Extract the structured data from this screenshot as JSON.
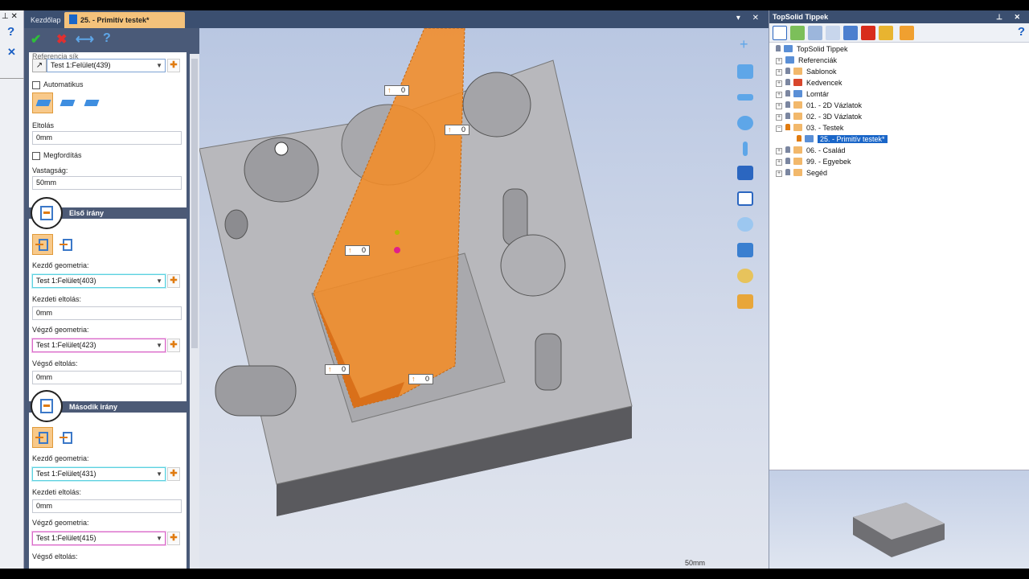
{
  "strip": {
    "pin": "⊥ ✕",
    "help": "?",
    "close": "✕"
  },
  "tabs": {
    "home": "Kezdőlap",
    "active": "25. - Primitív testek*",
    "controls": "▾ ✕"
  },
  "toolbar": {
    "ok": "✔",
    "cancel": "✖",
    "extra": "⟷",
    "help": "?"
  },
  "panel": {
    "ref_label": "Referencia sík",
    "ref_value": "Test 1:Felület(439)",
    "auto_label": "Automatikus",
    "offset_label": "Eltolás",
    "offset_value": "0mm",
    "flip_label": "Megfordítás",
    "thickness_label": "Vastagság:",
    "thickness_value": "50mm",
    "dir1": {
      "title": "Első irány",
      "start_geo_label": "Kezdő geometria:",
      "start_geo_value": "Test 1:Felület(403)",
      "start_offset_label": "Kezdeti eltolás:",
      "start_offset_value": "0mm",
      "end_geo_label": "Végző geometria:",
      "end_geo_value": "Test 1:Felület(423)",
      "end_offset_label": "Végső eltolás:",
      "end_offset_value": "0mm"
    },
    "dir2": {
      "title": "Második irány",
      "start_geo_label": "Kezdő geometria:",
      "start_geo_value": "Test 1:Felület(431)",
      "start_offset_label": "Kezdeti eltolás:",
      "start_offset_value": "0mm",
      "end_geo_label": "Végző geometria:",
      "end_geo_value": "Test 1:Felület(415)",
      "end_offset_label": "Végső eltolás:"
    }
  },
  "viewport": {
    "dims": [
      "0",
      "0",
      "0",
      "0",
      "0"
    ],
    "scale": "50mm"
  },
  "tree": {
    "title": "TopSolid Tippek",
    "controls": "⊥ ✕",
    "help": "?",
    "items": [
      "TopSolid Tippek",
      "Referenciák",
      "Sablonok",
      "Kedvencek",
      "Lomtár",
      "01. - 2D Vázlatok",
      "02. - 3D Vázlatok",
      "03. - Testek",
      "25. - Primitív testek*",
      "06. - Család",
      "99. - Egyebek",
      "Segéd"
    ]
  },
  "colors": {
    "accent": "#f28c28",
    "titlebar": "#3b4f70",
    "selection": "#1a66c8"
  }
}
